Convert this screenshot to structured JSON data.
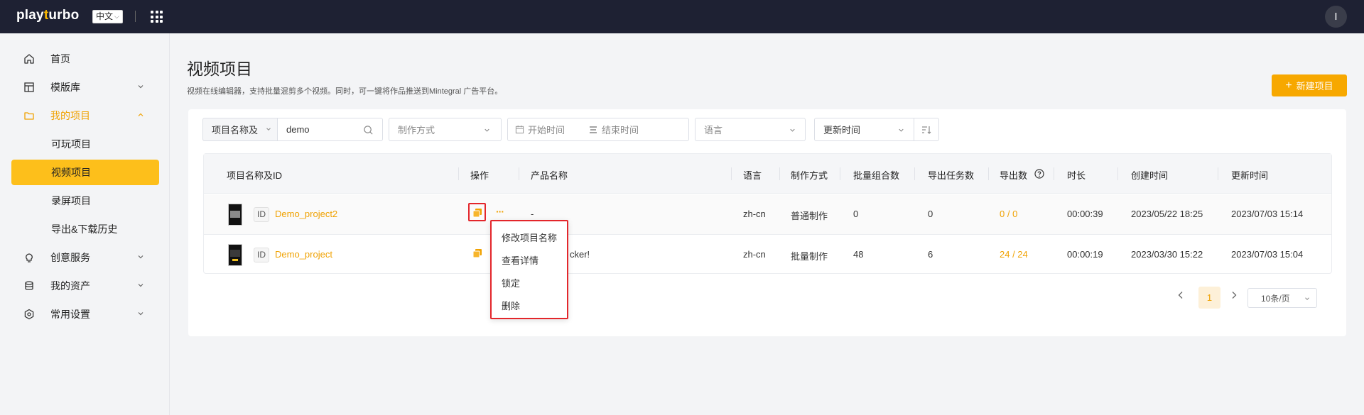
{
  "header": {
    "logo_text_a": "play",
    "logo_text_o": "t",
    "logo_text_b": "urbo",
    "lang_label": "中文",
    "avatar_initial": "I"
  },
  "sidebar": {
    "items": [
      {
        "label": "首页",
        "icon": "home-icon"
      },
      {
        "label": "模版库",
        "icon": "template-icon"
      },
      {
        "label": "我的项目",
        "icon": "folder-icon"
      },
      {
        "label": "可玩项目"
      },
      {
        "label": "视频项目"
      },
      {
        "label": "录屏项目"
      },
      {
        "label": "导出&下载历史"
      },
      {
        "label": "创意服务",
        "icon": "bulb-icon"
      },
      {
        "label": "我的资产",
        "icon": "database-icon"
      },
      {
        "label": "常用设置",
        "icon": "settings-icon"
      }
    ]
  },
  "main": {
    "title": "视频项目",
    "description": "视频在线编辑器，支持批量混剪多个视频。同时，可一键将作品推送到Mintegral 广告平台。",
    "new_button": "新建项目"
  },
  "filters": {
    "name_select": "项目名称及",
    "search_value": "demo",
    "method_placeholder": "制作方式",
    "start_time": "开始时间",
    "end_time": "结束时间",
    "language_placeholder": "语言",
    "sort_value": "更新时间"
  },
  "table": {
    "columns": [
      "项目名称及ID",
      "操作",
      "产品名称",
      "语言",
      "制作方式",
      "批量组合数",
      "导出任务数",
      "导出数",
      "时长",
      "创建时间",
      "更新时间"
    ],
    "rows": [
      {
        "id_badge": "ID",
        "name": "Demo_project2",
        "product": "-",
        "lang": "zh-cn",
        "method": "普通制作",
        "combos": "0",
        "tasks": "0",
        "exports": "0 / 0",
        "duration": "00:00:39",
        "created": "2023/05/22 18:25",
        "updated": "2023/07/03 15:14"
      },
      {
        "id_badge": "ID",
        "name": "Demo_project",
        "product": "cker!",
        "lang": "zh-cn",
        "method": "批量制作",
        "combos": "48",
        "tasks": "6",
        "exports": "24 / 24",
        "duration": "00:00:19",
        "created": "2023/03/30 15:22",
        "updated": "2023/07/03 15:04"
      }
    ]
  },
  "dropdown_menu": {
    "items": [
      "修改项目名称",
      "查看详情",
      "锁定",
      "删除"
    ]
  },
  "pagination": {
    "current_page": "1",
    "page_size": "10条/页"
  },
  "colors": {
    "accent": "#f7a800",
    "topbar": "#1e2133",
    "highlight": "#e3262b"
  }
}
